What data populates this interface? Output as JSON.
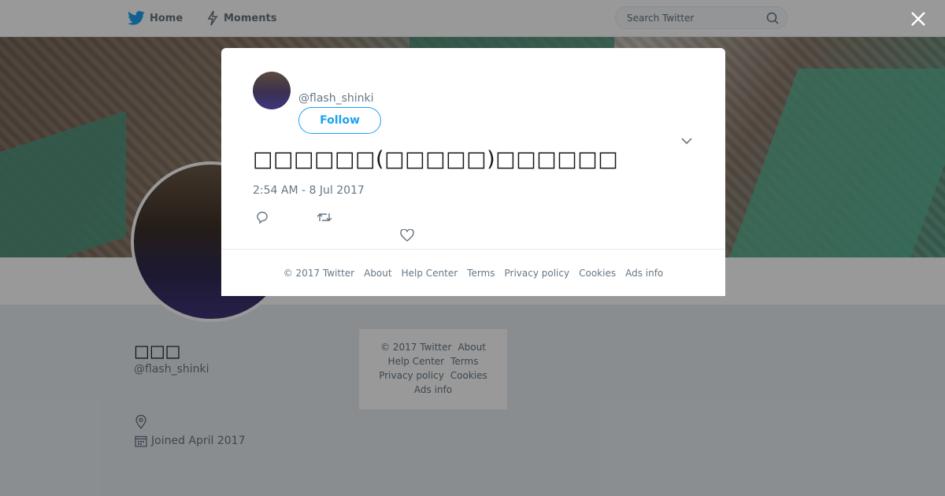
{
  "topbar": {
    "home_label": "Home",
    "moments_label": "Moments",
    "search_placeholder": "Search Twitter"
  },
  "profile": {
    "name": "□□□",
    "handle": "@flash_shinki",
    "joined": "Joined April 2017"
  },
  "side_footer": {
    "copyright": "© 2017 Twitter",
    "about": "About",
    "help_center": "Help Center",
    "terms": "Terms",
    "privacy": "Privacy policy",
    "cookies": "Cookies",
    "ads_info": "Ads info"
  },
  "tweet": {
    "handle": "@flash_shinki",
    "follow_label": "Follow",
    "text": "□□□□□□(□□□□□)□□□□□□",
    "timestamp": "2:54 AM - 8 Jul 2017"
  },
  "modal_footer": {
    "copyright": "© 2017 Twitter",
    "about": "About",
    "help_center": "Help Center",
    "terms": "Terms",
    "privacy": "Privacy policy",
    "cookies": "Cookies",
    "ads_info": "Ads info"
  },
  "colors": {
    "brand_blue": "#1da1f2",
    "muted_text": "#657786"
  },
  "icons": [
    "twitter-bird-icon",
    "moments-lightning-icon",
    "search-icon",
    "close-icon",
    "chevron-down-icon",
    "reply-icon",
    "retweet-icon",
    "like-heart-icon",
    "location-icon",
    "calendar-icon"
  ]
}
